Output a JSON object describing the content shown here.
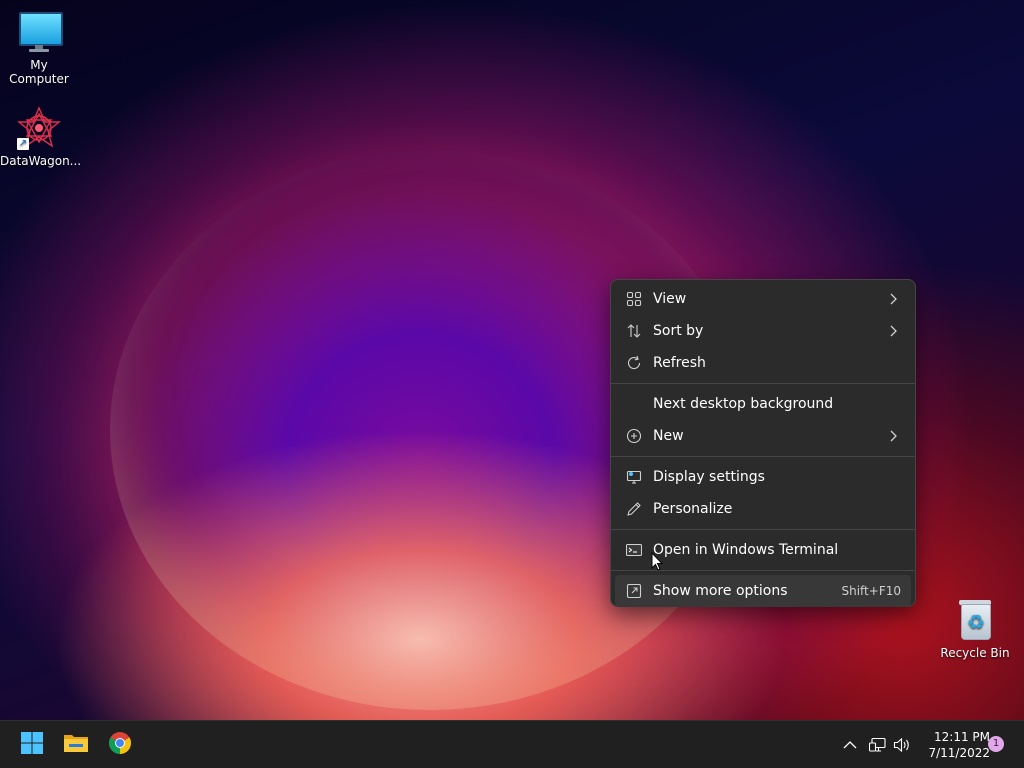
{
  "desktop": {
    "icons": [
      {
        "label": "My Computer",
        "icon": "monitor-icon"
      },
      {
        "label": "DataWagon...",
        "icon": "datawagon-logo-icon"
      },
      {
        "label": "Recycle Bin",
        "icon": "recycle-bin-icon"
      }
    ]
  },
  "context_menu": {
    "items": [
      {
        "label": "View",
        "icon": "grid-icon",
        "submenu": true
      },
      {
        "label": "Sort by",
        "icon": "sort-arrows-icon",
        "submenu": true
      },
      {
        "label": "Refresh",
        "icon": "refresh-icon",
        "submenu": false
      },
      {
        "label": "Next desktop background",
        "icon": "",
        "submenu": false
      },
      {
        "label": "New",
        "icon": "plus-circle-icon",
        "submenu": true
      },
      {
        "label": "Display settings",
        "icon": "display-settings-icon",
        "submenu": false
      },
      {
        "label": "Personalize",
        "icon": "pen-icon",
        "submenu": false
      },
      {
        "label": "Open in Windows Terminal",
        "icon": "terminal-icon",
        "submenu": false
      },
      {
        "label": "Show more options",
        "icon": "expand-icon",
        "shortcut": "Shift+F10",
        "submenu": false
      }
    ]
  },
  "taskbar": {
    "apps": [
      {
        "name": "start-button",
        "icon": "windows-logo-icon"
      },
      {
        "name": "file-explorer",
        "icon": "folder-icon"
      },
      {
        "name": "chrome",
        "icon": "chrome-icon"
      }
    ],
    "tray": {
      "icons": [
        "chevron-up-icon",
        "network-icon",
        "volume-icon"
      ],
      "time": "12:11 PM",
      "date": "7/11/2022",
      "notification_count": "1"
    }
  },
  "colors": {
    "menu_bg": "#2b2b2b",
    "taskbar_bg": "#202020",
    "accent": "#4cc2ff"
  }
}
